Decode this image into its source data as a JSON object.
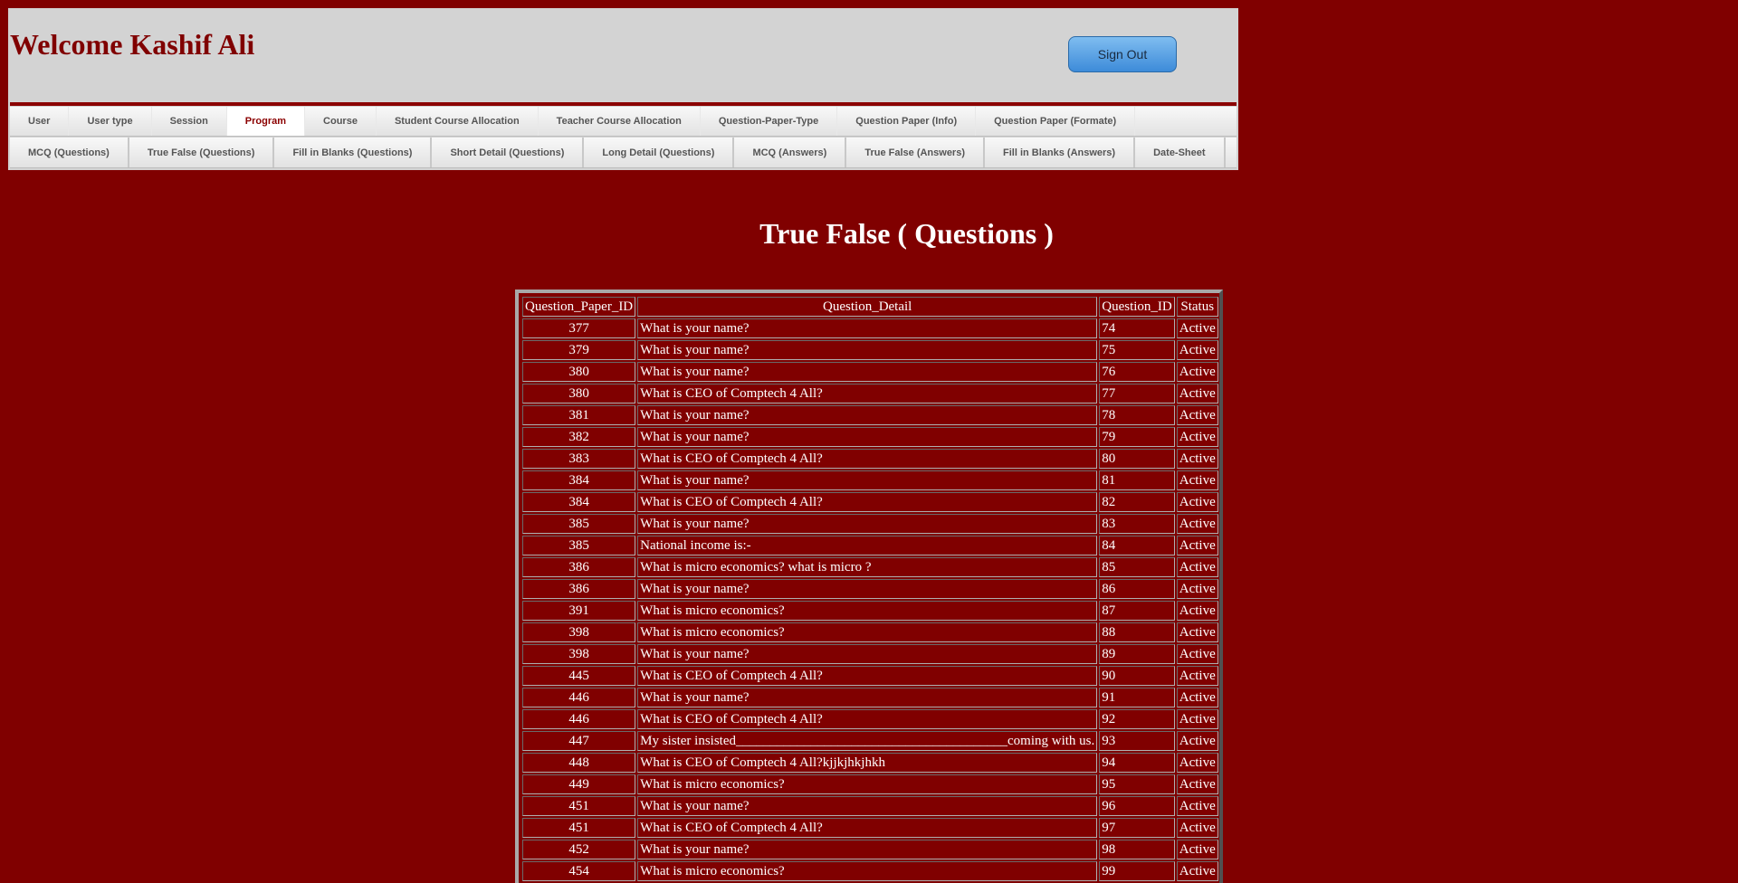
{
  "header": {
    "welcome": "Welcome Kashif Ali",
    "sign_out": "Sign Out"
  },
  "menu": {
    "row1": [
      {
        "label": "User"
      },
      {
        "label": "User type"
      },
      {
        "label": "Session"
      },
      {
        "label": "Program",
        "active": true
      },
      {
        "label": "Course"
      },
      {
        "label": "Student Course Allocation"
      },
      {
        "label": "Teacher Course Allocation"
      },
      {
        "label": "Question-Paper-Type"
      },
      {
        "label": "Question Paper (Info)"
      },
      {
        "label": "Question Paper (Formate)"
      }
    ],
    "row2": [
      {
        "label": "MCQ (Questions)"
      },
      {
        "label": "True False (Questions)"
      },
      {
        "label": "Fill in Blanks (Questions)"
      },
      {
        "label": "Short Detail (Questions)"
      },
      {
        "label": "Long Detail (Questions)"
      },
      {
        "label": "MCQ (Answers)"
      },
      {
        "label": "True False (Answers)"
      },
      {
        "label": "Fill in Blanks (Answers)"
      },
      {
        "label": "Date-Sheet"
      }
    ]
  },
  "page": {
    "title": "True False ( Questions )"
  },
  "table": {
    "columns": [
      "Question_Paper_ID",
      "Question_Detail",
      "Question_ID",
      "Status"
    ],
    "rows": [
      [
        "377",
        "What is your name?",
        "74",
        "Active"
      ],
      [
        "379",
        "What is your name?",
        "75",
        "Active"
      ],
      [
        "380",
        "What is your name?",
        "76",
        "Active"
      ],
      [
        "380",
        "What is CEO of Comptech 4 All?",
        "77",
        "Active"
      ],
      [
        "381",
        "What is your name?",
        "78",
        "Active"
      ],
      [
        "382",
        "What is your name?",
        "79",
        "Active"
      ],
      [
        "383",
        "What is CEO of Comptech 4 All?",
        "80",
        "Active"
      ],
      [
        "384",
        "What is your name?",
        "81",
        "Active"
      ],
      [
        "384",
        "What is CEO of Comptech 4 All?",
        "82",
        "Active"
      ],
      [
        "385",
        "What is your name?",
        "83",
        "Active"
      ],
      [
        "385",
        "National income is:-",
        "84",
        "Active"
      ],
      [
        "386",
        "What is micro economics? what is micro ?",
        "85",
        "Active"
      ],
      [
        "386",
        "What is your name?",
        "86",
        "Active"
      ],
      [
        "391",
        "What is micro economics?",
        "87",
        "Active"
      ],
      [
        "398",
        "What is micro economics?",
        "88",
        "Active"
      ],
      [
        "398",
        "What is your name?",
        "89",
        "Active"
      ],
      [
        "445",
        "What is CEO of Comptech 4 All?",
        "90",
        "Active"
      ],
      [
        "446",
        "What is your name?",
        "91",
        "Active"
      ],
      [
        "446",
        "What is CEO of Comptech 4 All?",
        "92",
        "Active"
      ],
      [
        "447",
        "My sister insisted________________________________________coming with us.",
        "93",
        "Active"
      ],
      [
        "448",
        "What is CEO of Comptech 4 All?kjjkjhkjhkh",
        "94",
        "Active"
      ],
      [
        "449",
        "What is micro economics?",
        "95",
        "Active"
      ],
      [
        "451",
        "What is your name?",
        "96",
        "Active"
      ],
      [
        "451",
        "What is CEO of Comptech 4 All?",
        "97",
        "Active"
      ],
      [
        "452",
        "What is your name?",
        "98",
        "Active"
      ],
      [
        "454",
        "What is micro economics?",
        "99",
        "Active"
      ]
    ]
  }
}
